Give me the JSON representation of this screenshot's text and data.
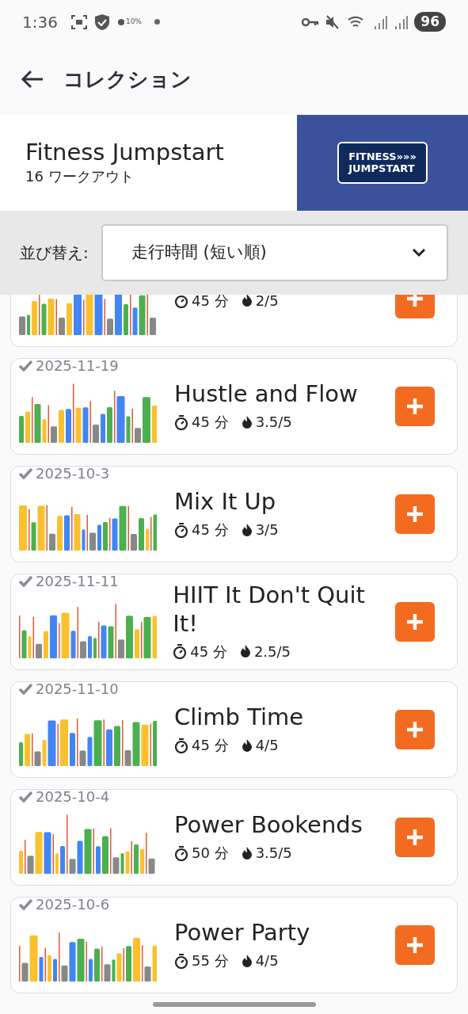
{
  "status_bar": {
    "time": "1:36",
    "brightness": "10%",
    "battery": "96"
  },
  "app_bar": {
    "title": "コレクション"
  },
  "collection": {
    "title": "Fitness Jumpstart",
    "subtitle": "16 ワークアウト",
    "logo_lines": [
      "FITNESS»»»",
      "JUMPSTART"
    ]
  },
  "sort": {
    "label": "並び替え:",
    "value": "走行時間 (短い順)"
  },
  "workouts": [
    {
      "duration": "45 分",
      "intensity": "2/5"
    },
    {
      "completed": true,
      "date": "2025-11-19",
      "title": "Hustle and Flow",
      "duration": "45 分",
      "intensity": "3.5/5"
    },
    {
      "completed": true,
      "date": "2025-10-3",
      "title": "Mix It Up",
      "duration": "45 分",
      "intensity": "3/5"
    },
    {
      "completed": true,
      "date": "2025-11-11",
      "title": "HIIT It Don't Quit It!",
      "duration": "45 分",
      "intensity": "2.5/5"
    },
    {
      "completed": true,
      "date": "2025-11-10",
      "title": "Climb Time",
      "duration": "45 分",
      "intensity": "4/5"
    },
    {
      "completed": true,
      "date": "2025-10-4",
      "title": "Power Bookends",
      "duration": "50 分",
      "intensity": "3.5/5"
    },
    {
      "completed": true,
      "date": "2025-10-6",
      "title": "Power Party",
      "duration": "55 分",
      "intensity": "4/5"
    }
  ]
}
